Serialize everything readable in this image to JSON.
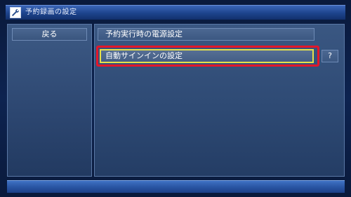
{
  "window": {
    "title": "予約録画の設定",
    "icon": "wrench-icon"
  },
  "sidebar": {
    "back_label": "戻る"
  },
  "main": {
    "header": "予約実行時の電源設定",
    "items": [
      {
        "label": "自動サインインの設定",
        "selected": true
      }
    ],
    "help_label": "?"
  },
  "colors": {
    "focus_outline": "#e3172a",
    "selection_border": "#e6e14a",
    "title_bar": "#1d438c"
  }
}
